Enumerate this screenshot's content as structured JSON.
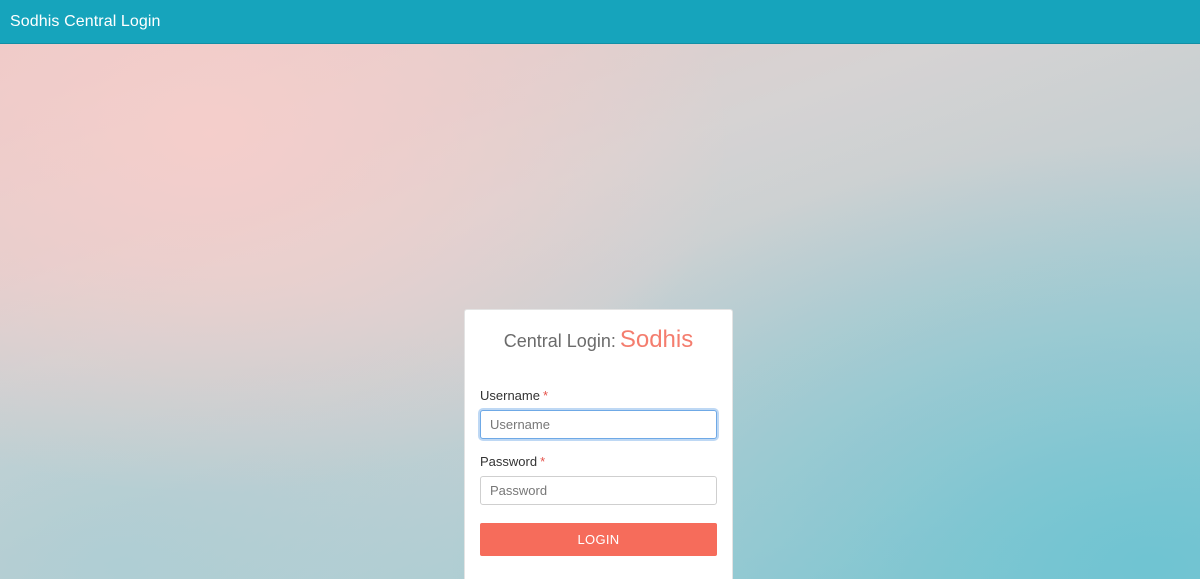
{
  "header": {
    "title": "Sodhis Central Login"
  },
  "login_card": {
    "title_prefix": "Central Login:",
    "title_brand": "Sodhis",
    "username": {
      "label": "Username",
      "required_mark": "*",
      "placeholder": "Username",
      "value": ""
    },
    "password": {
      "label": "Password",
      "required_mark": "*",
      "placeholder": "Password",
      "value": ""
    },
    "login_button_label": "LOGIN"
  },
  "colors": {
    "header_bg": "#16a4bc",
    "brand_accent": "#f47d6e",
    "button_bg": "#f66c5b",
    "required_mark": "#e5534b",
    "focus_ring": "#6fa9e6"
  }
}
